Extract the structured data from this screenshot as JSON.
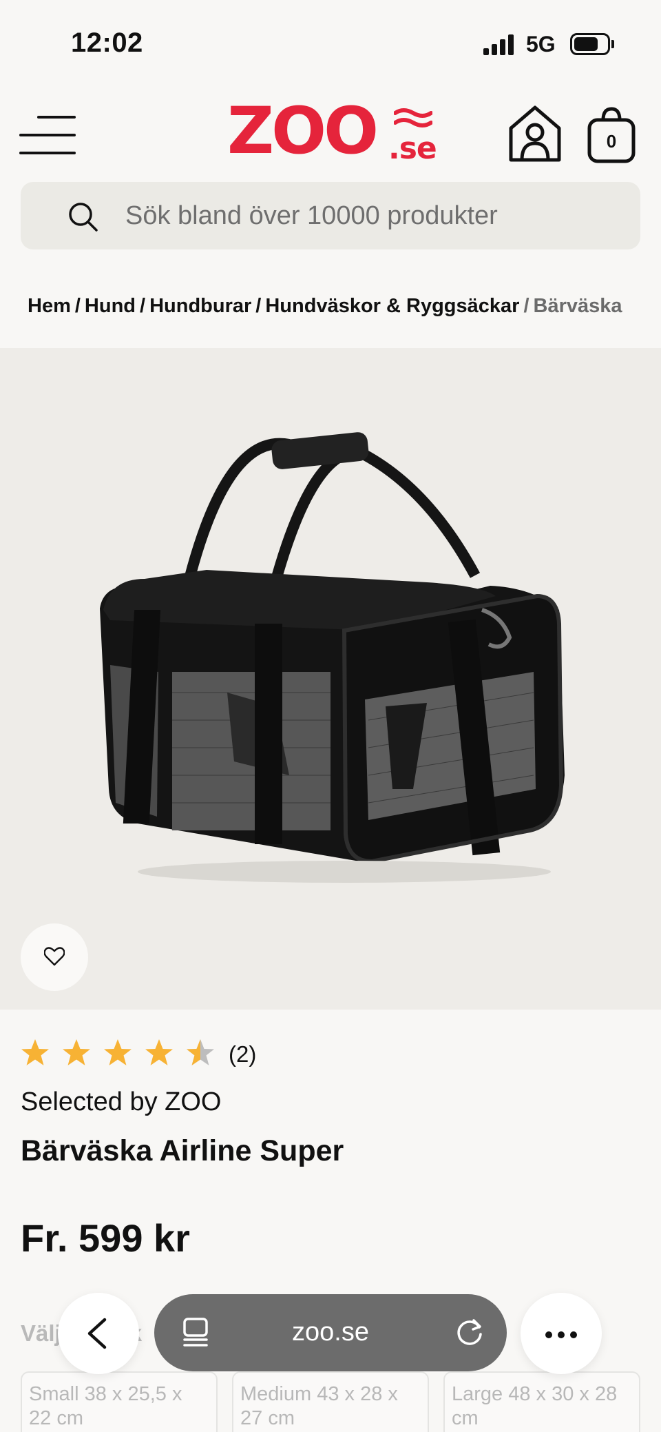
{
  "status_bar": {
    "time": "12:02",
    "network": "5G"
  },
  "header": {
    "logo_main": "ZOO",
    "logo_suffix": ".se",
    "cart_count": "0"
  },
  "search": {
    "placeholder": "Sök bland över 10000 produkter"
  },
  "breadcrumb": {
    "items": [
      "Hem",
      "Hund",
      "Hundburar",
      "Hundväskor & Ryggsäckar"
    ],
    "separator": "/",
    "current": "Bärväska"
  },
  "product": {
    "rating": 4.5,
    "rating_max": 5,
    "review_count": "(2)",
    "brand": "Selected by ZOO",
    "title": "Bärväska Airline Super",
    "price": "Fr. 599 kr",
    "variant_label": "Välj storlek",
    "variants": [
      "Small 38 x 25,5 x 22 cm",
      "Medium 43 x 28 x 27 cm",
      "Large 48 x 30 x 28 cm"
    ]
  },
  "browser": {
    "url": "zoo.se"
  },
  "colors": {
    "brand": "#e5243b",
    "star": "#f7b234",
    "star_empty": "#bdbdbd"
  },
  "icons": [
    "menu-icon",
    "house-icon",
    "cart-icon",
    "search-icon",
    "heart-icon",
    "star-icon",
    "chevron-left-icon",
    "tabs-icon",
    "reload-icon",
    "more-icon"
  ]
}
